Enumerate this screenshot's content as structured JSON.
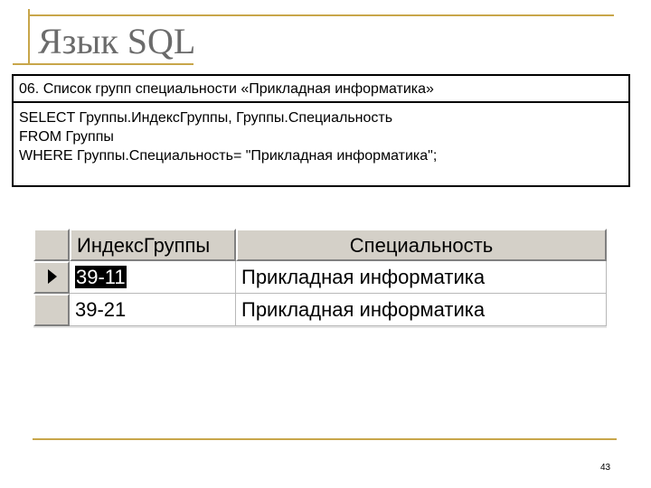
{
  "slide": {
    "title": "Язык SQL",
    "page_number": "43"
  },
  "query": {
    "header": "06. Список групп специальности «Прикладная информатика»",
    "lines": [
      "SELECT  Группы.ИндексГруппы, Группы.Специальность",
      "FROM Группы",
      "WHERE Группы.Специальность= \"Прикладная информатика\";"
    ]
  },
  "result_grid": {
    "columns": [
      "ИндексГруппы",
      "Специальность"
    ],
    "rows": [
      {
        "index": "39-11",
        "specialty": "Прикладная информатика",
        "current": true
      },
      {
        "index": "39-21",
        "specialty": "Прикладная информатика",
        "current": false
      }
    ]
  },
  "colors": {
    "accent_line": "#c8a64a",
    "title_text": "#6b6b6b",
    "grid_header_bg": "#d4d0c8",
    "selection_bg": "#000000"
  }
}
